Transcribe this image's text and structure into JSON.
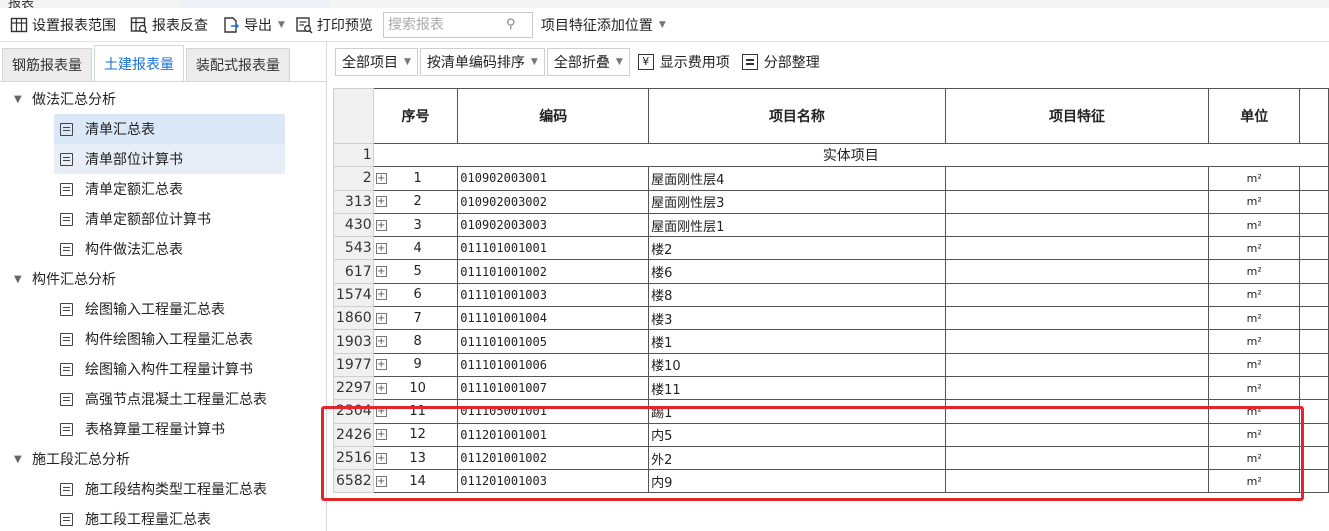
{
  "window": {
    "title": "报表"
  },
  "toolbar": {
    "set_range": "设置报表范围",
    "report_check": "报表反查",
    "export": "导出",
    "print_preview": "打印预览",
    "search_placeholder": "搜索报表",
    "feature_position": "项目特征添加位置"
  },
  "tabs": [
    {
      "label": "钢筋报表量",
      "active": false
    },
    {
      "label": "土建报表量",
      "active": true
    },
    {
      "label": "装配式报表量",
      "active": false
    }
  ],
  "tree": {
    "groups": [
      {
        "label": "做法汇总分析",
        "items": [
          "清单汇总表",
          "清单部位计算书",
          "清单定额汇总表",
          "清单定额部位计算书",
          "构件做法汇总表"
        ]
      },
      {
        "label": "构件汇总分析",
        "items": [
          "绘图输入工程量汇总表",
          "构件绘图输入工程量汇总表",
          "绘图输入构件工程量计算书",
          "高强节点混凝土工程量汇总表",
          "表格算量工程量计算书"
        ]
      },
      {
        "label": "施工段汇总分析",
        "items": [
          "施工段结构类型工程量汇总表",
          "施工段工程量汇总表"
        ]
      }
    ]
  },
  "right_toolbar": {
    "all_items": "全部项目",
    "sort_by_code": "按清单编码排序",
    "collapse_all": "全部折叠",
    "show_fee": "显示费用项",
    "section_arrange": "分部整理"
  },
  "table": {
    "headers": {
      "seq": "序号",
      "code": "编码",
      "name": "项目名称",
      "feature": "项目特征",
      "unit": "单位"
    },
    "section_row": {
      "num": "1",
      "label": "实体项目"
    },
    "rows": [
      {
        "num": "2",
        "seq": "1",
        "code": "010902003001",
        "name": "屋面刚性层4",
        "unit": "m²"
      },
      {
        "num": "313",
        "seq": "2",
        "code": "010902003002",
        "name": "屋面刚性层3",
        "unit": "m²"
      },
      {
        "num": "430",
        "seq": "3",
        "code": "010902003003",
        "name": "屋面刚性层1",
        "unit": "m²"
      },
      {
        "num": "543",
        "seq": "4",
        "code": "011101001001",
        "name": "楼2",
        "unit": "m²"
      },
      {
        "num": "617",
        "seq": "5",
        "code": "011101001002",
        "name": "楼6",
        "unit": "m²"
      },
      {
        "num": "1574",
        "seq": "6",
        "code": "011101001003",
        "name": "楼8",
        "unit": "m²"
      },
      {
        "num": "1860",
        "seq": "7",
        "code": "011101001004",
        "name": "楼3",
        "unit": "m²"
      },
      {
        "num": "1903",
        "seq": "8",
        "code": "011101001005",
        "name": "楼1",
        "unit": "m²"
      },
      {
        "num": "1977",
        "seq": "9",
        "code": "011101001006",
        "name": "楼10",
        "unit": "m²"
      },
      {
        "num": "2297",
        "seq": "10",
        "code": "011101001007",
        "name": "楼11",
        "unit": "m²"
      },
      {
        "num": "2304",
        "seq": "11",
        "code": "011105001001",
        "name": "踢1",
        "unit": "m²"
      },
      {
        "num": "2426",
        "seq": "12",
        "code": "011201001001",
        "name": "内5",
        "unit": "m²"
      },
      {
        "num": "2516",
        "seq": "13",
        "code": "011201001002",
        "name": "外2",
        "unit": "m²"
      },
      {
        "num": "6582",
        "seq": "14",
        "code": "011201001003",
        "name": "内9",
        "unit": "m²"
      }
    ]
  },
  "colors": {
    "accent": "#1a73d9",
    "highlight_border": "#e3262b",
    "selection": "#d9e7f7"
  }
}
